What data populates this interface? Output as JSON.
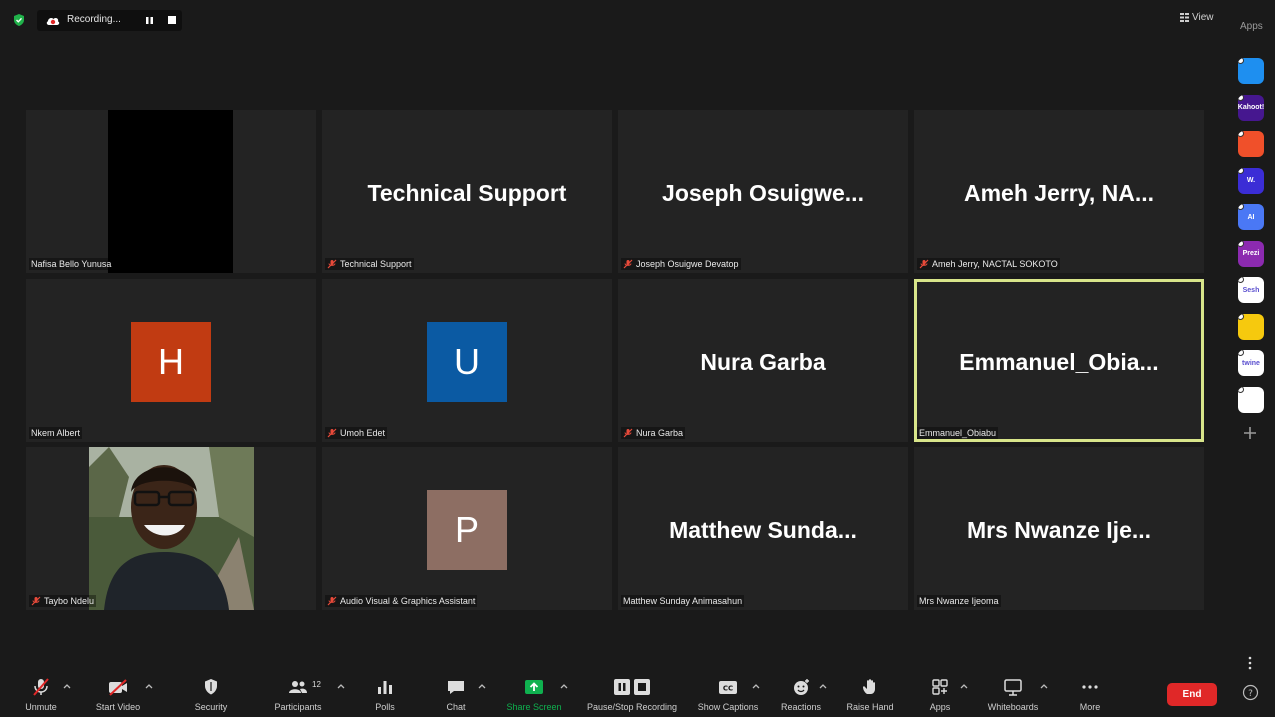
{
  "topbar": {
    "recording_label": "Recording...",
    "view_label": "View"
  },
  "apps": {
    "label": "Apps",
    "items": [
      {
        "name": "pitch-app",
        "color": "#1e8ff0",
        "text": ""
      },
      {
        "name": "kahoot-app",
        "color": "#46178f",
        "text": "Kahoot!"
      },
      {
        "name": "orange-app",
        "color": "#f0502a",
        "text": ""
      },
      {
        "name": "wordwall-app",
        "color": "#3b2dd6",
        "text": "W."
      },
      {
        "name": "ai-app",
        "color": "#4a78f5",
        "text": "AI"
      },
      {
        "name": "prezi-app",
        "color": "#8c2ab0",
        "text": "Prezi"
      },
      {
        "name": "sesh-app",
        "color": "#ffffff",
        "text": "Sesh"
      },
      {
        "name": "emoji-app",
        "color": "#f6c90e",
        "text": ""
      },
      {
        "name": "twine-app",
        "color": "#ffffff",
        "text": "twine"
      },
      {
        "name": "blocks-app",
        "color": "#ffffff",
        "text": ""
      }
    ]
  },
  "participants": [
    {
      "label": "Nafisa Bello Yunusa",
      "display": "",
      "muted": false,
      "type": "video-black"
    },
    {
      "label": "Technical Support",
      "display": "Technical Support",
      "muted": true,
      "type": "name"
    },
    {
      "label": "Joseph Osuigwe Devatop",
      "display": "Joseph Osuigwe...",
      "muted": true,
      "type": "name"
    },
    {
      "label": "Ameh Jerry, NACTAL SOKOTO",
      "display": "Ameh Jerry, NA...",
      "muted": true,
      "type": "name"
    },
    {
      "label": "Nkem Albert",
      "display": "H",
      "muted": false,
      "type": "avatar",
      "color": "#c13b12"
    },
    {
      "label": "Umoh Edet",
      "display": "U",
      "muted": true,
      "type": "avatar",
      "color": "#0b5aa3"
    },
    {
      "label": "Nura Garba",
      "display": "Nura Garba",
      "muted": true,
      "type": "name"
    },
    {
      "label": "Emmanuel_Obiabu",
      "display": "Emmanuel_Obia...",
      "muted": false,
      "type": "name",
      "active": true
    },
    {
      "label": "Taybo Ndelu",
      "display": "",
      "muted": true,
      "type": "photo"
    },
    {
      "label": "Audio Visual & Graphics Assistant",
      "display": "P",
      "muted": true,
      "type": "avatar",
      "color": "#8d6e63"
    },
    {
      "label": "Matthew Sunday Animasahun",
      "display": "Matthew Sunda...",
      "muted": false,
      "type": "name"
    },
    {
      "label": "Mrs Nwanze Ijeoma",
      "display": "Mrs Nwanze Ije...",
      "muted": false,
      "type": "name"
    }
  ],
  "toolbar": {
    "unmute": "Unmute",
    "start_video": "Start Video",
    "security": "Security",
    "participants": "Participants",
    "participants_count": "12",
    "polls": "Polls",
    "chat": "Chat",
    "share_screen": "Share Screen",
    "pause_stop_recording": "Pause/Stop Recording",
    "show_captions": "Show Captions",
    "reactions": "Reactions",
    "raise_hand": "Raise Hand",
    "apps": "Apps",
    "whiteboards": "Whiteboards",
    "more": "More",
    "end": "End"
  },
  "colors": {
    "active_speaker": "#d8e58a",
    "share_green": "#0fb14f",
    "end_red": "#e02828"
  }
}
